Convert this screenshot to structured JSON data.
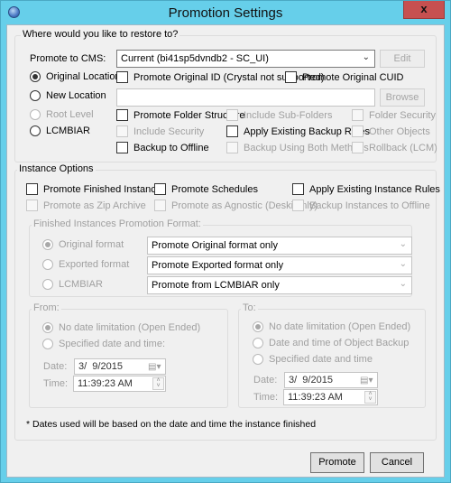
{
  "window": {
    "title": "Promotion Settings",
    "close_label": "x"
  },
  "restore_group": {
    "label": "Where would you like to restore to?",
    "cms_label": "Promote to CMS:",
    "cms_value": "Current (bi41sp5dvndb2 - SC_UI)",
    "edit_label": "Edit",
    "browse_label": "Browse",
    "new_location_path": "",
    "radios": [
      {
        "label": "Original Location",
        "checked": true,
        "enabled": true
      },
      {
        "label": "New Location",
        "checked": false,
        "enabled": true
      },
      {
        "label": "Root Level",
        "checked": false,
        "enabled": false
      },
      {
        "label": "LCMBIAR",
        "checked": false,
        "enabled": true
      }
    ],
    "checkboxes": {
      "promote_original_id": {
        "label": "Promote Original ID (Crystal not supported)",
        "checked": false,
        "enabled": true
      },
      "promote_original_cuid": {
        "label": "Promote Original CUID",
        "checked": false,
        "enabled": true
      },
      "promote_folder_structure": {
        "label": "Promote Folder Structure",
        "checked": false,
        "enabled": true
      },
      "include_sub_folders": {
        "label": "Include Sub-Folders",
        "checked": false,
        "enabled": false
      },
      "folder_security": {
        "label": "Folder Security",
        "checked": false,
        "enabled": false
      },
      "include_security": {
        "label": "Include Security",
        "checked": false,
        "enabled": false
      },
      "apply_existing_backup_rules": {
        "label": "Apply Existing Backup Rules",
        "checked": false,
        "enabled": true
      },
      "other_objects": {
        "label": "Other Objects",
        "checked": false,
        "enabled": false
      },
      "backup_to_offline": {
        "label": "Backup to Offline",
        "checked": false,
        "enabled": true
      },
      "backup_using_both_methods": {
        "label": "Backup Using Both Methods",
        "checked": false,
        "enabled": false
      },
      "rollback_lcm": {
        "label": "Rollback (LCM)",
        "checked": false,
        "enabled": false
      }
    }
  },
  "instance_group": {
    "label": "Instance Options",
    "checkboxes": {
      "promote_finished_instances": {
        "label": "Promote Finished Instances",
        "checked": false,
        "enabled": true
      },
      "promote_schedules": {
        "label": "Promote Schedules",
        "checked": false,
        "enabled": true
      },
      "apply_existing_instance_rules": {
        "label": "Apply Existing Instance Rules",
        "checked": false,
        "enabled": true
      },
      "promote_as_zip_archive": {
        "label": "Promote as Zip Archive",
        "checked": false,
        "enabled": false
      },
      "promote_as_agnostic": {
        "label": "Promote as Agnostic (Deski only)",
        "checked": false,
        "enabled": false
      },
      "backup_instances_to_offline": {
        "label": "Backup Instances to Offline",
        "checked": false,
        "enabled": false
      }
    },
    "format_group": {
      "label": "Finished Instances Promotion Format:",
      "rows": [
        {
          "radio_label": "Original format",
          "checked": true,
          "combo_value": "Promote Original format only"
        },
        {
          "radio_label": "Exported format",
          "checked": false,
          "combo_value": "Promote Exported format only"
        },
        {
          "radio_label": "LCMBIAR",
          "checked": false,
          "combo_value": "Promote from LCMBIAR only"
        }
      ]
    },
    "from_group": {
      "label": "From:",
      "radios": [
        {
          "label": "No date limitation (Open Ended)",
          "checked": true
        },
        {
          "label": "Specified date and time:",
          "checked": false
        }
      ],
      "date_label": "Date:",
      "date_value": "3/  9/2015",
      "time_label": "Time:",
      "time_value": "11:39:23 AM"
    },
    "to_group": {
      "label": "To:",
      "radios": [
        {
          "label": "No date limitation (Open Ended)",
          "checked": true
        },
        {
          "label": "Date and time of Object Backup",
          "checked": false
        },
        {
          "label": "Specified date and time",
          "checked": false
        }
      ],
      "date_label": "Date:",
      "date_value": "3/  9/2015",
      "time_label": "Time:",
      "time_value": "11:39:23 AM"
    },
    "footnote": "* Dates used will be based on the date and time the instance finished"
  },
  "footer": {
    "promote_label": "Promote",
    "cancel_label": "Cancel"
  }
}
